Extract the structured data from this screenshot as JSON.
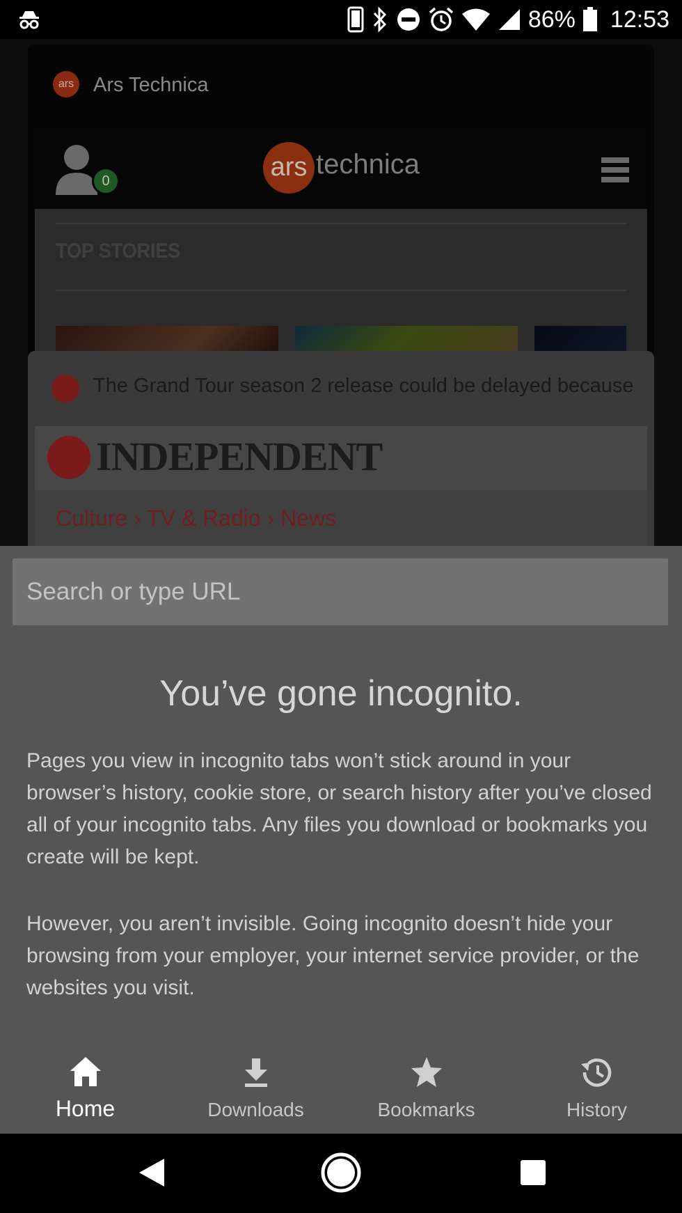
{
  "status_bar": {
    "battery": "86%",
    "time": "12:53"
  },
  "background_tabs": {
    "tab1": {
      "favicon_text": "ars",
      "title": "Ars Technica",
      "user_badge": "0",
      "logo_circle": "ars",
      "logo_text": "technica",
      "section": "TOP STORIES"
    },
    "tab2": {
      "title": "The Grand Tour season 2 release could be delayed because",
      "masthead": "INDEPENDENT",
      "breadcrumbs": "Culture › TV & Radio › News"
    }
  },
  "search": {
    "placeholder": "Search or type URL"
  },
  "incognito": {
    "title": "You’ve gone incognito.",
    "para1": "Pages you view in incognito tabs won’t stick around in your browser’s history, cookie store, or search history after you’ve closed all of your incognito tabs. Any files you download or bookmarks you create will be kept.",
    "para2": "However, you aren’t invisible. Going incognito doesn’t hide your browsing from your employer, your internet service provider, or the websites you visit."
  },
  "bottom_nav": {
    "home": "Home",
    "downloads": "Downloads",
    "bookmarks": "Bookmarks",
    "history": "History"
  }
}
